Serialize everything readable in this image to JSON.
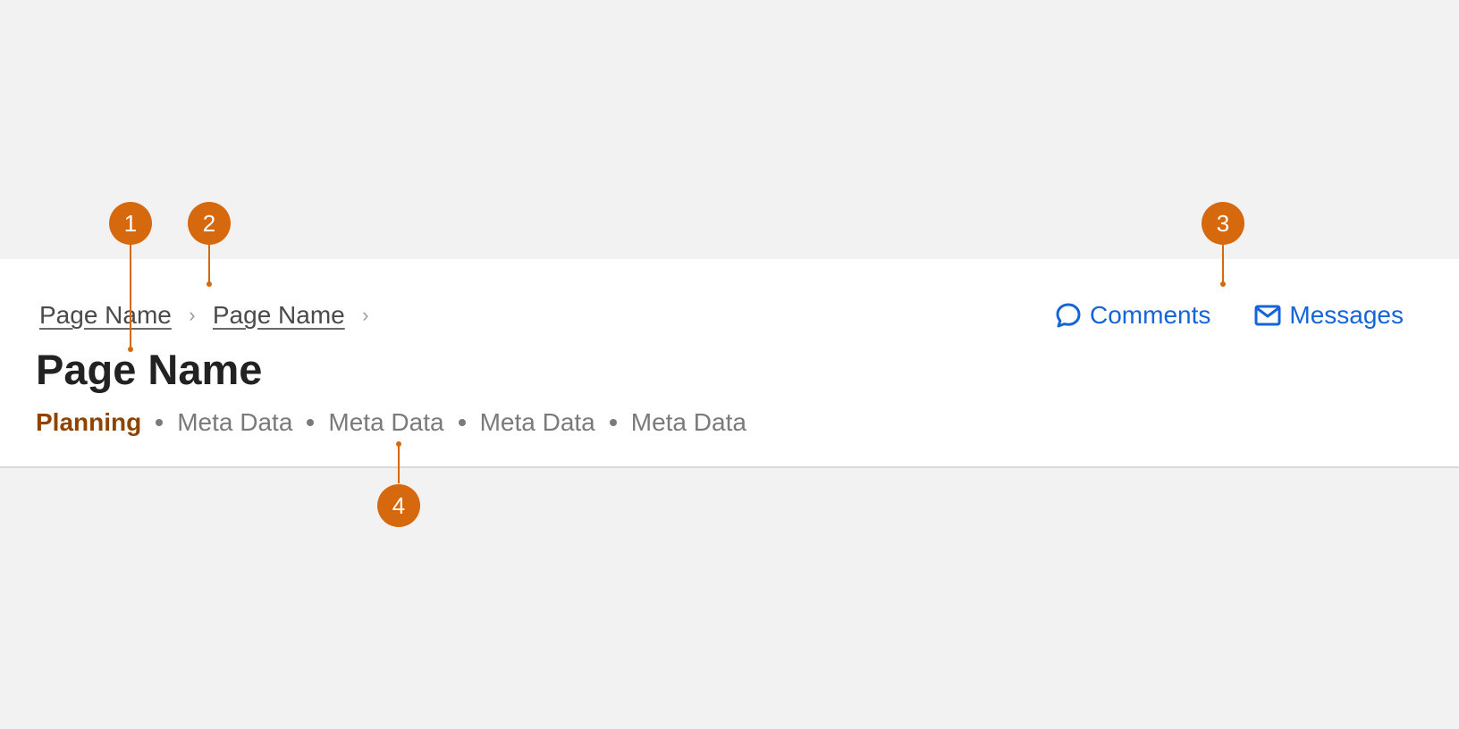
{
  "breadcrumb": {
    "items": [
      {
        "label": "Page Name"
      },
      {
        "label": "Page Name"
      }
    ],
    "separator": "›"
  },
  "page_title": "Page Name",
  "meta": {
    "status": "Planning",
    "status_color": "#8e4400",
    "items": [
      "Meta Data",
      "Meta Data",
      "Meta Data",
      "Meta Data"
    ]
  },
  "actions": {
    "comments": {
      "label": "Comments",
      "icon": "comment-bubble-icon"
    },
    "messages": {
      "label": "Messages",
      "icon": "envelope-icon"
    },
    "color": "#1565d8"
  },
  "annotations": {
    "markers": [
      "1",
      "2",
      "3",
      "4"
    ],
    "color": "#d6680d"
  }
}
